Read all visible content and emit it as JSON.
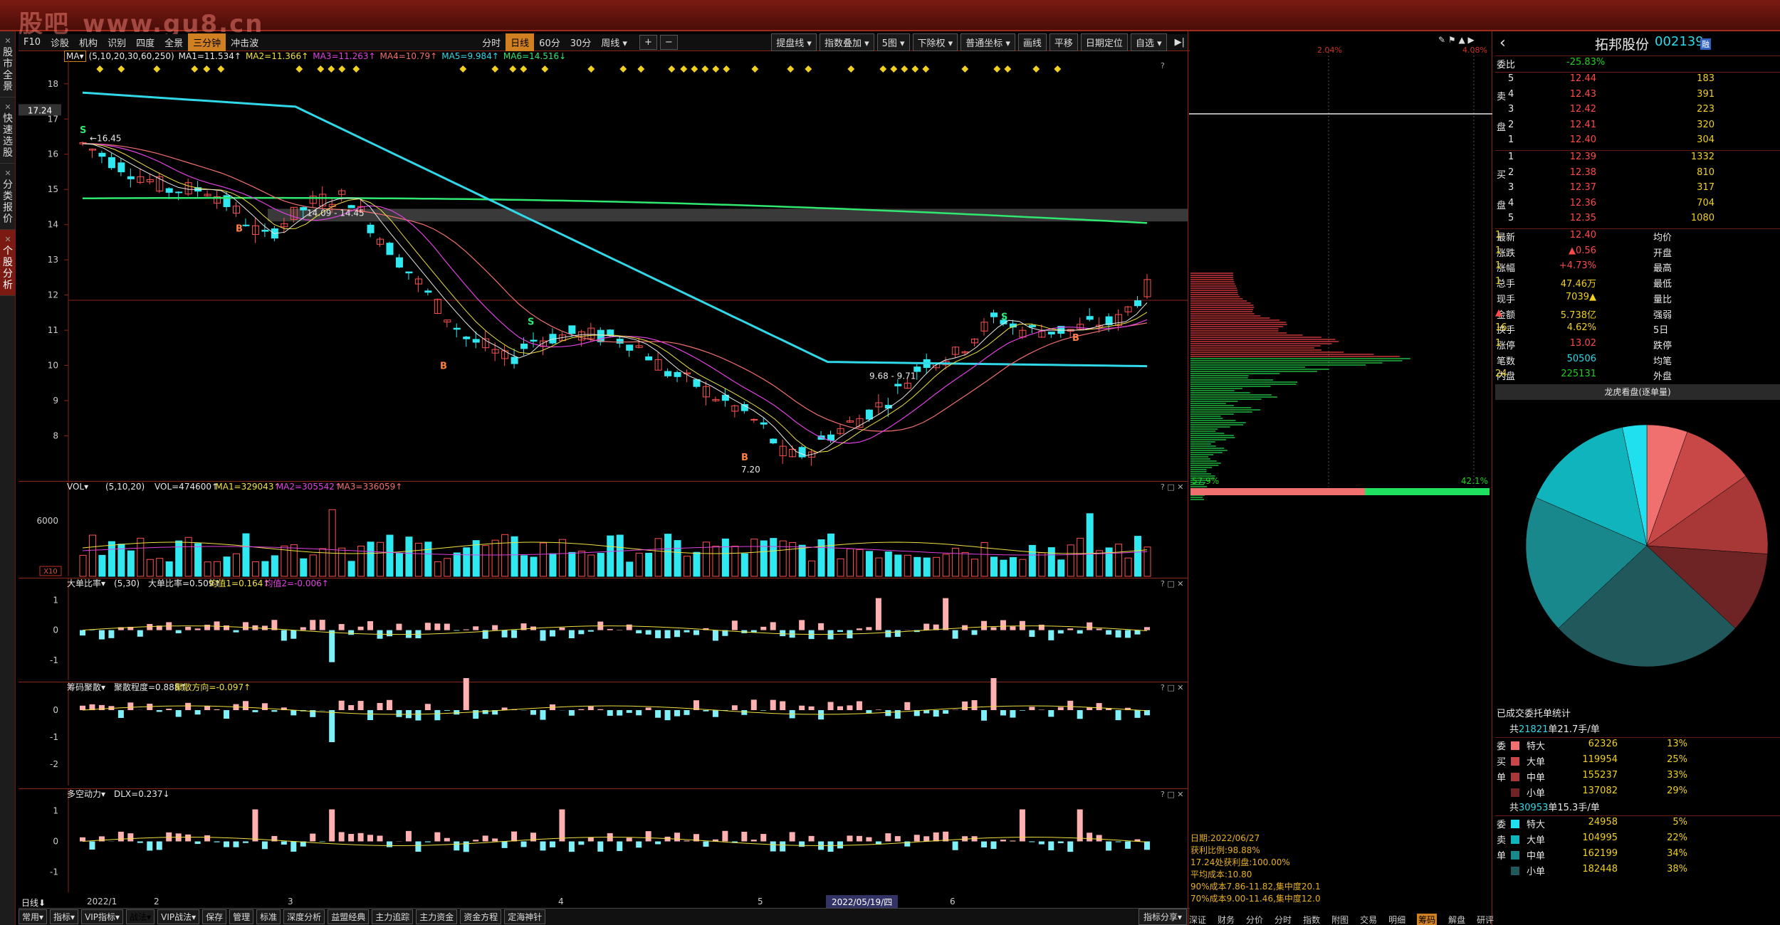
{
  "logo_text": "股吧",
  "logo_url": "www.gu8.cn",
  "top_menu": [
    "",
    "",
    "",
    "",
    "",
    "",
    "",
    ""
  ],
  "left_tabs": [
    {
      "label": "股市全景",
      "active": false
    },
    {
      "label": "快速选股",
      "active": false
    },
    {
      "label": "分类报价",
      "active": false
    },
    {
      "label": "个股分析",
      "active": true
    }
  ],
  "toolbar": {
    "left": [
      "F10",
      "诊股",
      "机构",
      "识别",
      "四度",
      "全景",
      "三分钟",
      "冲击波"
    ],
    "left_active": "三分钟",
    "period": [
      "分时",
      "日线",
      "60分",
      "30分",
      "周线"
    ],
    "period_active": "日线",
    "right": [
      "提盘线",
      "指数叠加",
      "5图",
      "下除权",
      "普通坐标",
      "画线",
      "平移",
      "日期定位",
      "自选"
    ]
  },
  "ma_line": {
    "label": "MA",
    "params": "(5,10,20,30,60,250)",
    "items": [
      {
        "text": "MA1=11.534↑",
        "color": "#e8e8e8"
      },
      {
        "text": "MA2=11.366↑",
        "color": "#f0e040"
      },
      {
        "text": "MA3=11.263↑",
        "color": "#e040e0"
      },
      {
        "text": "MA4=10.79↑",
        "color": "#f07070"
      },
      {
        "text": "MA5=9.984↑",
        "color": "#30d8e8"
      },
      {
        "text": "MA6=14.516↓",
        "color": "#30e870"
      }
    ]
  },
  "price_axis": [
    "18",
    "17",
    "16",
    "15",
    "14",
    "13",
    "12",
    "11",
    "10",
    "9",
    "8"
  ],
  "price_tag": "17.24",
  "annotations": {
    "high_label": "16.45",
    "range1": "14.09 - 14.45",
    "range2": "9.68 - 9.71",
    "low_label": "7.20",
    "s_mark": "S",
    "b_mark": "B"
  },
  "vol_panel": {
    "label": "VOL",
    "params": "(5,10,20)",
    "items": [
      {
        "text": "VOL=474600↑",
        "color": "#e8e8e8"
      },
      {
        "text": "MA1=329043↑",
        "color": "#f0e040"
      },
      {
        "text": "MA2=305542↑",
        "color": "#e040e0"
      },
      {
        "text": "MA3=336059↑",
        "color": "#f07070"
      }
    ],
    "axis": [
      "6000",
      "X10"
    ]
  },
  "big_order_panel": {
    "label": "大单比率",
    "params": "(5,30)",
    "items": [
      {
        "text": "大单比率=0.509↑",
        "color": "#e8e8e8"
      },
      {
        "text": "均值1=0.164↑",
        "color": "#f0e040"
      },
      {
        "text": "均值2=-0.006↑",
        "color": "#e040e0"
      }
    ],
    "axis": [
      "1",
      "0",
      "-1"
    ]
  },
  "chip_conc_panel": {
    "label": "筹码聚散",
    "items": [
      {
        "text": "聚散程度=0.888↑",
        "color": "#e8e8e8"
      },
      {
        "text": "聚散方向=-0.097↑",
        "color": "#f0e040"
      }
    ],
    "axis": [
      "0",
      "-1",
      "-2"
    ]
  },
  "dlx_panel": {
    "label": "多空动力",
    "items": [
      {
        "text": "DLX=0.237↓",
        "color": "#e8e8e8"
      }
    ],
    "axis": [
      "1",
      "0",
      "-1"
    ]
  },
  "x_axis": {
    "left_label": "日线",
    "labels": [
      "2022/1",
      "2",
      "3",
      "4",
      "5",
      "6"
    ],
    "highlight": "2022/05/19/四"
  },
  "bottom_tabs": [
    "常用",
    "指标",
    "VIP指标",
    "战法",
    "VIP战法",
    "保存",
    "管理",
    "标准",
    "深度分析",
    "益盟经典",
    "主力追踪",
    "主力资金",
    "资金方程",
    "定海神针"
  ],
  "bottom_active": "战法",
  "bottom_right": "指标分享",
  "chip": {
    "top_left": "2.04%",
    "top_right": "4.08%",
    "bottom_left": "57.9%",
    "bottom_right": "42.1%",
    "info": [
      "日期:2022/06/27",
      "获利比例:98.88%",
      "17.24处获利盘:100.00%",
      "平均成本:10.80",
      "90%成本7.86-11.82,集中度20.1",
      "70%成本9.00-11.46,集中度12.0"
    ],
    "bottom_tabs": [
      "深证",
      "财务",
      "分价",
      "分时",
      "指数",
      "附图",
      "交易",
      "明细",
      "筹码",
      "解盘",
      "研评"
    ]
  },
  "quote": {
    "name": "拓邦股份",
    "code": "002139",
    "tag": "融",
    "webi_label": "委比",
    "webi": "-25.83%",
    "sell": [
      {
        "label": "5",
        "price": "12.44",
        "vol": "183"
      },
      {
        "label": "4",
        "price": "12.43",
        "vol": "391"
      },
      {
        "label": "3",
        "price": "12.42",
        "vol": "223"
      },
      {
        "label": "2",
        "price": "12.41",
        "vol": "320"
      },
      {
        "label": "1",
        "price": "12.40",
        "vol": "304"
      }
    ],
    "sell_side": [
      "卖",
      "盘"
    ],
    "buy": [
      {
        "label": "1",
        "price": "12.39",
        "vol": "1332"
      },
      {
        "label": "2",
        "price": "12.38",
        "vol": "810"
      },
      {
        "label": "3",
        "price": "12.37",
        "vol": "317"
      },
      {
        "label": "4",
        "price": "12.36",
        "vol": "704"
      },
      {
        "label": "5",
        "price": "12.35",
        "vol": "1080"
      }
    ],
    "buy_side": [
      "买",
      "盘"
    ],
    "stats": [
      {
        "l": "最新",
        "v": "12.40",
        "vc": "red",
        "l2": "均价",
        "v2": "1"
      },
      {
        "l": "涨跌",
        "v": "▲0.56",
        "vc": "red",
        "l2": "开盘",
        "v2": "1"
      },
      {
        "l": "涨幅",
        "v": "+4.73%",
        "vc": "red",
        "l2": "最高",
        "v2": "1"
      },
      {
        "l": "总手",
        "v": "47.46万",
        "vc": "yellow",
        "l2": "最低",
        "v2": "1"
      },
      {
        "l": "现手",
        "v": "7039▲",
        "vc": "yellow",
        "l2": "量比",
        "v2": ""
      },
      {
        "l": "金额",
        "v": "5.738亿",
        "vc": "yellow",
        "l2": "强弱",
        "v2": "▲"
      },
      {
        "l": "换手",
        "v": "4.62%",
        "vc": "yellow",
        "l2": "5日",
        "v2": "16."
      },
      {
        "l": "涨停",
        "v": "13.02",
        "vc": "red",
        "l2": "跌停",
        "v2": "1"
      },
      {
        "l": "笔数",
        "v": "50506",
        "vc": "cyan",
        "l2": "均笔",
        "v2": ""
      },
      {
        "l": "内盘",
        "v": "225131",
        "vc": "green",
        "l2": "外盘",
        "v2": "24"
      }
    ],
    "pie_title": "龙虎看盘(逐单量)",
    "pie_slices": [
      {
        "value": 5,
        "color": "#f07070"
      },
      {
        "value": 9,
        "color": "#c84848"
      },
      {
        "value": 10,
        "color": "#a83838"
      },
      {
        "value": 10,
        "color": "#6e2424"
      },
      {
        "value": 24,
        "color": "#20585c"
      },
      {
        "value": 17,
        "color": "#18888c"
      },
      {
        "value": 14,
        "color": "#10b4bc"
      },
      {
        "value": 3,
        "color": "#20e0f0"
      }
    ],
    "stats_title": "已成交委托单统计",
    "buy_group": {
      "header_prefix": "共",
      "header_num": "21821",
      "header_suffix": "单21.7手/单",
      "side": [
        "委",
        "买",
        "单"
      ],
      "rows": [
        {
          "c": "#f07070",
          "n": "特大",
          "v": "62326",
          "p": "13%"
        },
        {
          "c": "#c84848",
          "n": "大单",
          "v": "119954",
          "p": "25%"
        },
        {
          "c": "#a83838",
          "n": "中单",
          "v": "155237",
          "p": "33%"
        },
        {
          "c": "#6e2424",
          "n": "小单",
          "v": "137082",
          "p": "29%"
        }
      ]
    },
    "sell_group": {
      "header_prefix": "共",
      "header_num": "30953",
      "header_suffix": "单15.3手/单",
      "side": [
        "委",
        "卖",
        "单"
      ],
      "rows": [
        {
          "c": "#20e0f0",
          "n": "特大",
          "v": "24958",
          "p": "5%"
        },
        {
          "c": "#10b4bc",
          "n": "大单",
          "v": "104995",
          "p": "22%"
        },
        {
          "c": "#18888c",
          "n": "中单",
          "v": "162199",
          "p": "34%"
        },
        {
          "c": "#20585c",
          "n": "小单",
          "v": "182448",
          "p": "38%"
        }
      ]
    }
  }
}
